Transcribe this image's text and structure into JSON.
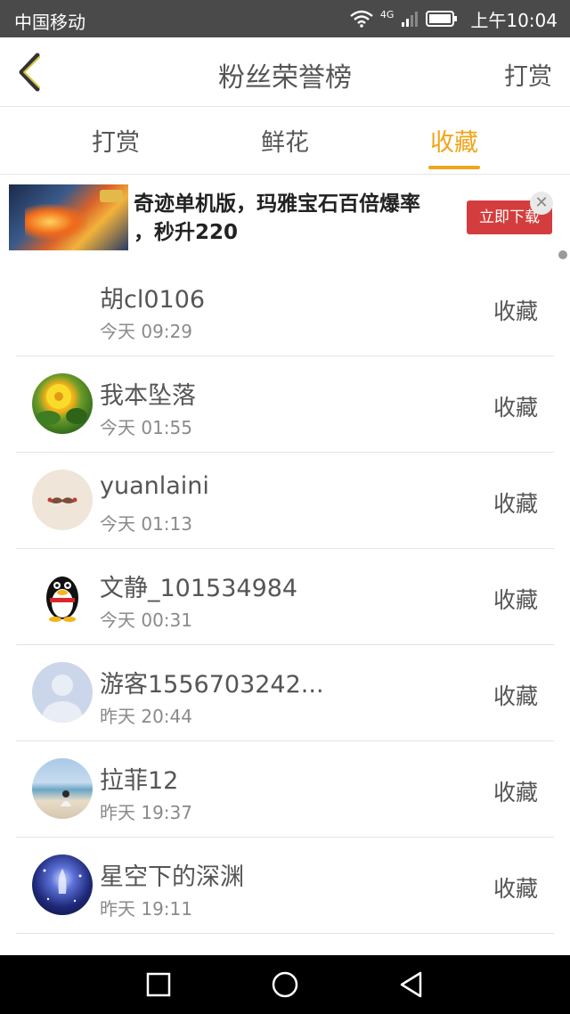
{
  "status_bar": {
    "carrier": "中国移动",
    "network": "4G",
    "time": "上午10:04"
  },
  "header": {
    "title": "粉丝荣誉榜",
    "right_action": "打赏",
    "back_icon": "chevron-left-icon"
  },
  "tabs": [
    {
      "label": "打赏",
      "active": false
    },
    {
      "label": "鲜花",
      "active": false
    },
    {
      "label": "收藏",
      "active": true
    }
  ],
  "accent_color": "#f0a51a",
  "ad": {
    "text_line1": "奇迹单机版，玛雅宝石百倍爆率",
    "text_line2": "，秒升220",
    "button_label": "立即下载",
    "close_icon": "close-icon"
  },
  "list": [
    {
      "name": "胡cl0106",
      "time": "今天 09:29",
      "action": "收藏",
      "avatar": "none"
    },
    {
      "name": "我本坠落",
      "time": "今天 01:55",
      "action": "收藏",
      "avatar": "flower"
    },
    {
      "name": "yuanlaini",
      "time": "今天 01:13",
      "action": "收藏",
      "avatar": "mustache"
    },
    {
      "name": "文静_101534984",
      "time": "今天 00:31",
      "action": "收藏",
      "avatar": "penguin"
    },
    {
      "name": "游客1556703242...",
      "time": "昨天 20:44",
      "action": "收藏",
      "avatar": "guest"
    },
    {
      "name": "拉菲12",
      "time": "昨天 19:37",
      "action": "收藏",
      "avatar": "beach"
    },
    {
      "name": "星空下的深渊",
      "time": "昨天 19:11",
      "action": "收藏",
      "avatar": "starry"
    }
  ],
  "nav_bar": {
    "recents_icon": "square-icon",
    "home_icon": "circle-icon",
    "back_icon": "triangle-back-icon"
  }
}
